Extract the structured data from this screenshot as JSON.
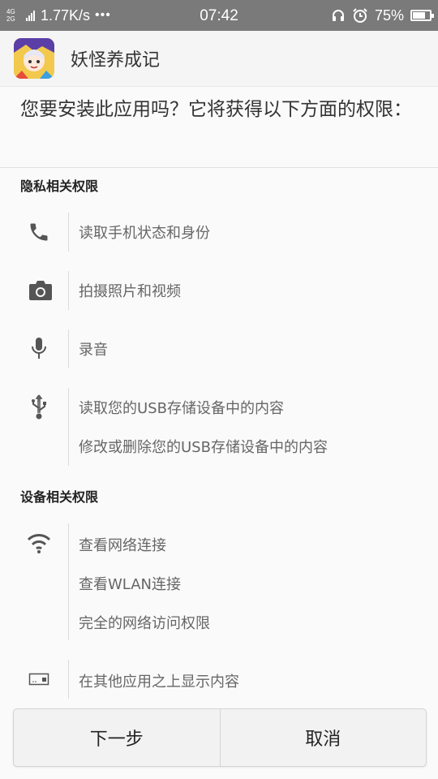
{
  "status_bar": {
    "network_top": "4G",
    "network_bottom": "2G",
    "speed": "1.77K/s",
    "more": "•••",
    "time": "07:42",
    "battery": "75%",
    "battery_level": 0.75,
    "icons": [
      "headset-icon",
      "alarm-icon",
      "battery-icon"
    ]
  },
  "app": {
    "name": "妖怪养成记",
    "icon": "app-avatar-icon"
  },
  "question": "您要安装此应用吗？它将获得以下方面的权限：",
  "sections": {
    "privacy": {
      "title": "隐私相关权限",
      "items": {
        "phone": {
          "icon": "phone-icon",
          "texts": [
            "读取手机状态和身份"
          ]
        },
        "camera": {
          "icon": "camera-icon",
          "texts": [
            "拍摄照片和视频"
          ]
        },
        "mic": {
          "icon": "microphone-icon",
          "texts": [
            "录音"
          ]
        },
        "usb": {
          "icon": "usb-icon",
          "texts": [
            "读取您的USB存储设备中的内容",
            "修改或删除您的USB存储设备中的内容"
          ]
        }
      }
    },
    "device": {
      "title": "设备相关权限",
      "items": {
        "network": {
          "icon": "wifi-icon",
          "texts": [
            "查看网络连接",
            "查看WLAN连接",
            "完全的网络访问权限"
          ]
        },
        "overlay": {
          "icon": "overlay-icon",
          "texts": [
            "在其他应用之上显示内容"
          ]
        }
      }
    }
  },
  "buttons": {
    "next": "下一步",
    "cancel": "取消"
  }
}
